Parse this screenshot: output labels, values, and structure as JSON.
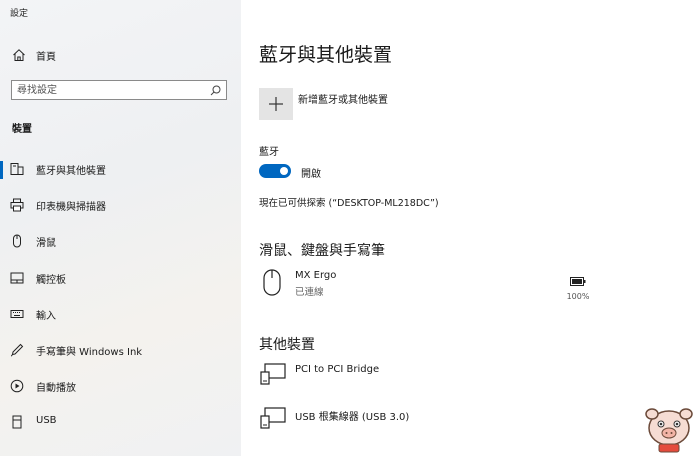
{
  "app": {
    "title": "設定"
  },
  "sidebar": {
    "home_label": "首頁",
    "search_placeholder": "尋找設定",
    "section_title": "裝置",
    "items": [
      {
        "label": "藍牙與其他裝置",
        "icon": "bluetooth-devices-icon",
        "active": true
      },
      {
        "label": "印表機與掃描器",
        "icon": "printer-icon"
      },
      {
        "label": "滑鼠",
        "icon": "mouse-icon"
      },
      {
        "label": "觸控板",
        "icon": "touchpad-icon"
      },
      {
        "label": "輸入",
        "icon": "keyboard-icon"
      },
      {
        "label": "手寫筆與 Windows Ink",
        "icon": "pen-icon"
      },
      {
        "label": "自動播放",
        "icon": "autoplay-icon"
      },
      {
        "label": "USB",
        "icon": "usb-icon"
      }
    ]
  },
  "main": {
    "title": "藍牙與其他裝置",
    "add_device_label": "新增藍牙或其他裝置",
    "bluetooth_label": "藍牙",
    "toggle_state": "開啟",
    "discoverable_text": "現在已可供探索 (“DESKTOP-ML218DC”)",
    "mouse_section_title": "滑鼠、鍵盤與手寫筆",
    "mouse_device": {
      "name": "MX Ergo",
      "status": "已連線",
      "battery": "100%"
    },
    "other_section_title": "其他裝置",
    "other_devices": [
      {
        "name": "PCI to PCI Bridge"
      },
      {
        "name": "USB 根集線器 (USB 3.0)"
      }
    ]
  },
  "colors": {
    "accent": "#0067c0",
    "sidebar_bg": "#f0f1f3"
  }
}
